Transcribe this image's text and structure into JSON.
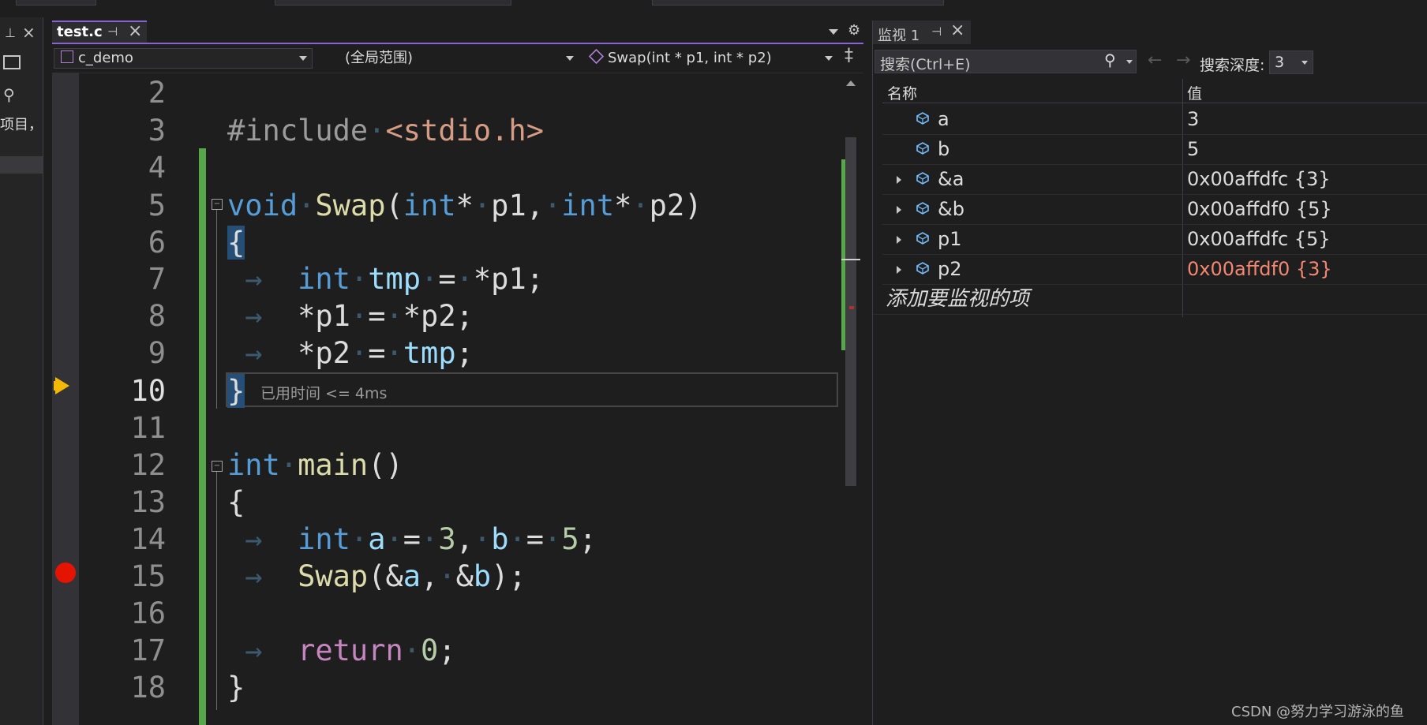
{
  "left_panel": {
    "fragment": "项目，"
  },
  "editor": {
    "tab": {
      "title": "test.c"
    },
    "nav": {
      "project": "c_demo",
      "scope": "(全局范围)",
      "function": "Swap(int * p1, int * p2)"
    },
    "lines": [
      {
        "num": "2"
      },
      {
        "num": "3"
      },
      {
        "num": "4"
      },
      {
        "num": "5"
      },
      {
        "num": "6"
      },
      {
        "num": "7"
      },
      {
        "num": "8"
      },
      {
        "num": "9"
      },
      {
        "num": "10"
      },
      {
        "num": "11"
      },
      {
        "num": "12"
      },
      {
        "num": "13"
      },
      {
        "num": "14"
      },
      {
        "num": "15"
      },
      {
        "num": "16"
      },
      {
        "num": "17"
      },
      {
        "num": "18"
      }
    ],
    "perf_tip": "已用时间 <= 4ms"
  },
  "watch": {
    "title": "监视 1",
    "search_placeholder": "搜索(Ctrl+E)",
    "depth_label": "搜索深度:",
    "depth_value": "3",
    "col_name": "名称",
    "col_value": "值",
    "rows": [
      {
        "name": "a",
        "value": "3"
      },
      {
        "name": "b",
        "value": "5"
      },
      {
        "name": "&a",
        "value": "0x00affdfc {3}"
      },
      {
        "name": "&b",
        "value": "0x00affdf0 {5}"
      },
      {
        "name": "p1",
        "value": "0x00affdfc {5}"
      },
      {
        "name": "p2",
        "value": "0x00affdf0 {3}"
      }
    ],
    "add_item": "添加要监视的项"
  },
  "watermark": "CSDN @努力学习游泳的鱼",
  "colors": {
    "accent": "#8a63d2",
    "changed_value": "#f48771",
    "breakpoint": "#e51400",
    "current_line_arrow": "#f5b800"
  },
  "icons": [
    "pin-icon",
    "close-icon",
    "search-icon",
    "back-arrow-icon",
    "forward-arrow-icon",
    "gear-icon",
    "split-icon",
    "variable-icon",
    "breakpoint-icon",
    "instruction-pointer-icon"
  ]
}
